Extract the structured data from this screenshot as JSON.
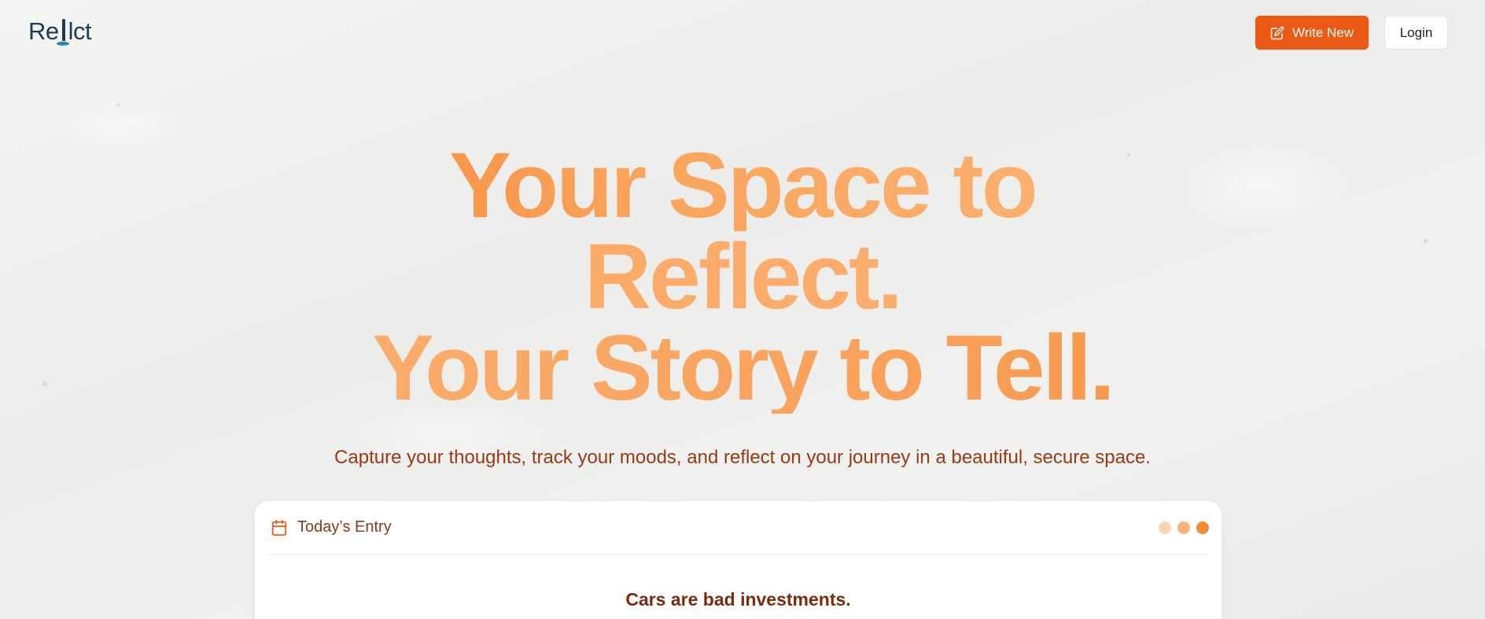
{
  "header": {
    "logo": {
      "left": "Re",
      "right": "lct"
    },
    "write_label": "Write New",
    "login_label": "Login"
  },
  "hero": {
    "line1": "Your Space to",
    "line2": "Reflect.",
    "line3": "Your Story to Tell.",
    "subtitle": "Capture your thoughts, track your moods, and reflect on your journey in a beautiful, secure space."
  },
  "card": {
    "label": "Today’s Entry",
    "entry_title": "Cars are bad investments.",
    "dot_colors": [
      "#fcd3b0",
      "#f9b27a",
      "#f48a35"
    ]
  },
  "colors": {
    "accent": "#ea5a14",
    "text_brown": "#9a3a14",
    "logo": "#1f3a55"
  }
}
